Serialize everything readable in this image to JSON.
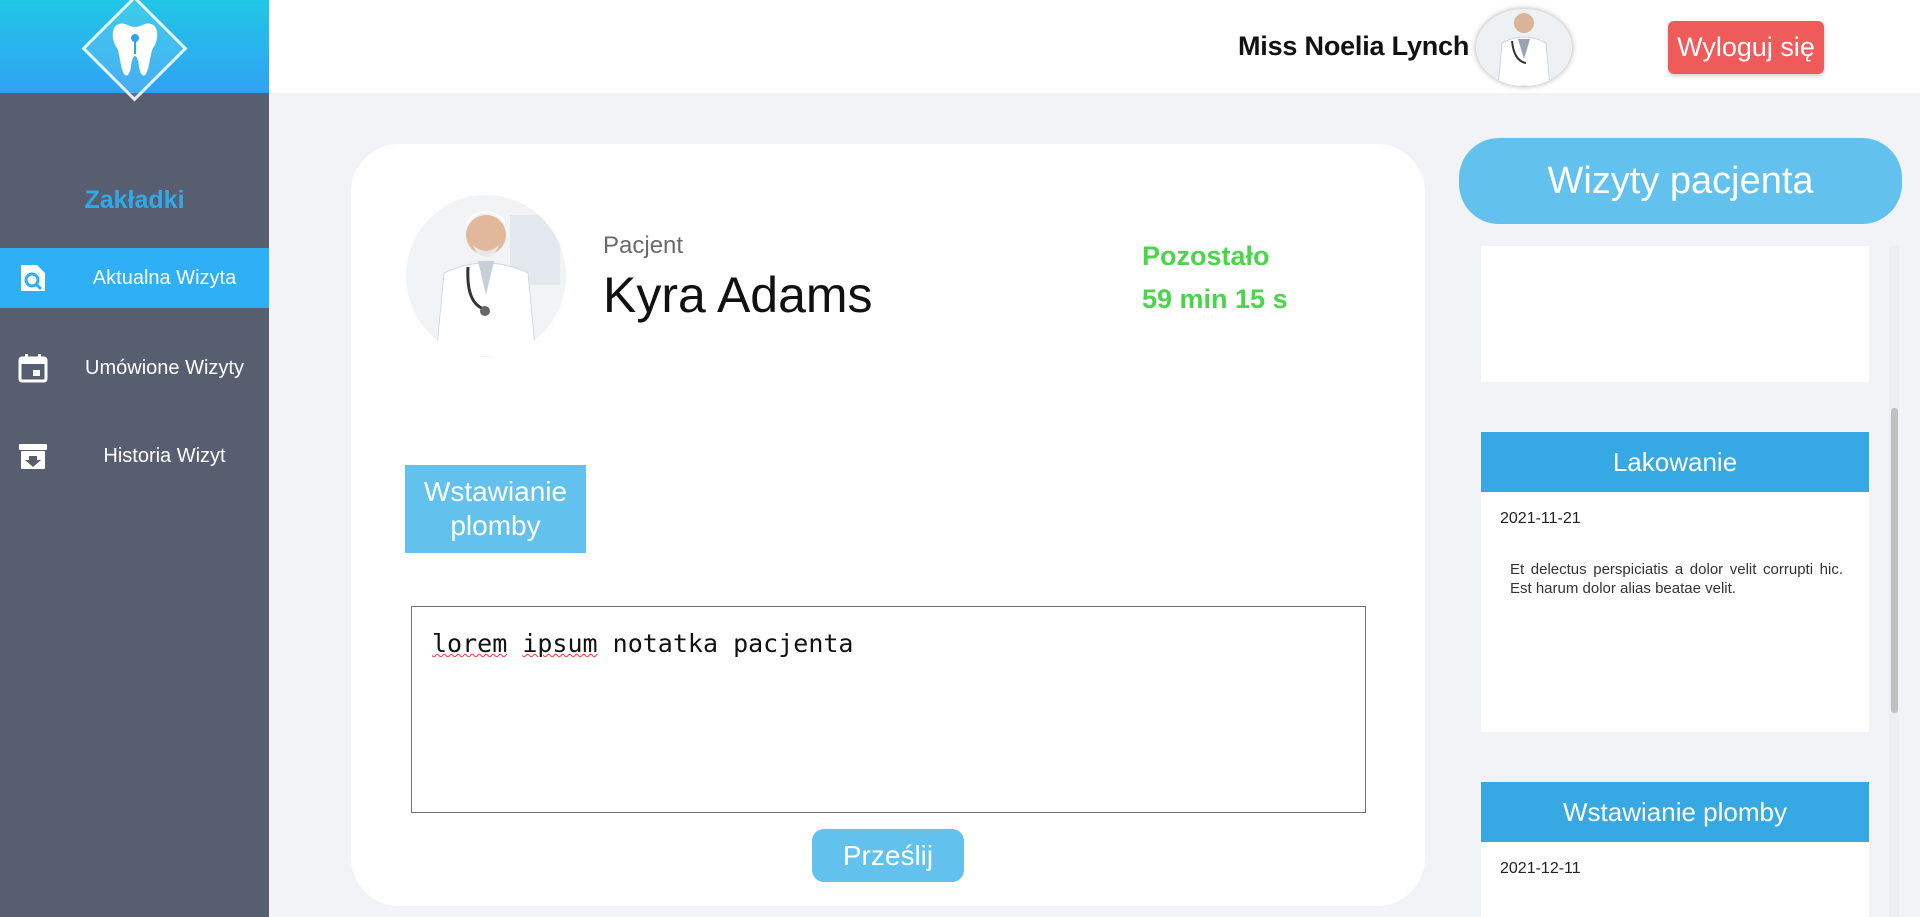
{
  "sidebar": {
    "heading": "Zakładki",
    "items": [
      {
        "label": "Aktualna Wizyta",
        "icon": "search-document-icon",
        "active": true
      },
      {
        "label": "Umówione Wizyty",
        "icon": "calendar-icon",
        "active": false
      },
      {
        "label": "Historia Wizyt",
        "icon": "archive-icon",
        "active": false
      }
    ]
  },
  "header": {
    "user_name": "Miss Noelia Lynch",
    "logout_label": "Wyloguj się"
  },
  "patient": {
    "label": "Pacjent",
    "name": "Kyra Adams",
    "remaining_label": "Pozostało",
    "remaining_time": "59 min 15 s",
    "procedure": "Wstawianie plomby",
    "note_words": [
      "lorem",
      "ipsum",
      "notatka pacjenta"
    ],
    "submit_label": "Prześlij"
  },
  "visits": {
    "title": "Wizyty pacjenta",
    "items": [
      {
        "title": "Lakowanie",
        "date": "2021-11-21",
        "description": "Et delectus perspiciatis a dolor velit corrupti hic. Est harum dolor alias beatae velit."
      },
      {
        "title": "Wstawianie plomby",
        "date": "2021-12-11",
        "description": ""
      }
    ]
  },
  "colors": {
    "sidebar_bg": "#565e6f",
    "accent_blue": "#2fb0f6",
    "light_blue": "#62c2ed",
    "logout_red": "#ef5b5b",
    "timer_green": "#4bd54b"
  }
}
